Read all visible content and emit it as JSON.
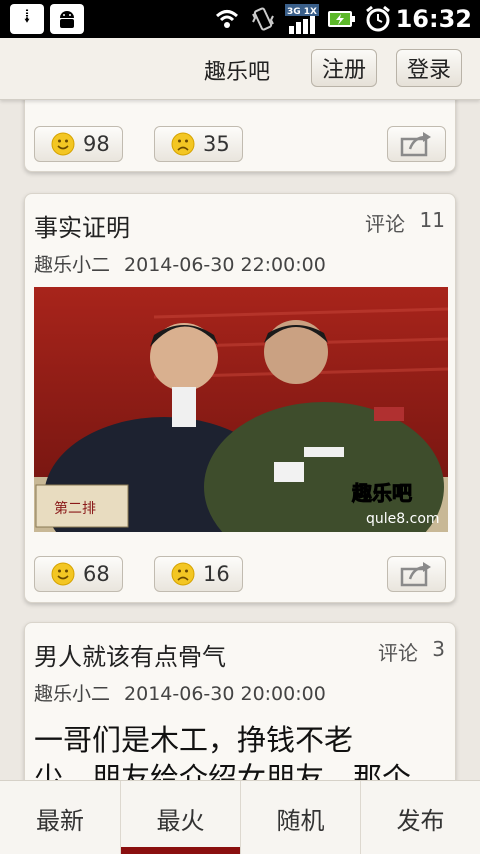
{
  "status_bar": {
    "time": "16:32",
    "network_label": "3G 1X",
    "icons": [
      "usb-icon",
      "android-icon",
      "wifi-icon",
      "vibrate-icon",
      "signal-icon",
      "battery-charging-icon",
      "alarm-icon"
    ]
  },
  "header": {
    "title": "趣乐吧",
    "register_label": "注册",
    "login_label": "登录"
  },
  "posts": [
    {
      "up_votes": "98",
      "down_votes": "35"
    },
    {
      "title": "事实证明",
      "comment_label": "评论",
      "comment_count": "11",
      "author": "趣乐小二",
      "date": "2014-06-30 22:00:00",
      "image_placard": "第二排",
      "image_watermark_brand": "趣乐吧",
      "image_watermark_url": "qule8.com",
      "up_votes": "68",
      "down_votes": "16"
    },
    {
      "title": "男人就该有点骨气",
      "comment_label": "评论",
      "comment_count": "3",
      "author": "趣乐小二",
      "date": "2014-06-30 20:00:00",
      "body_line1": "一哥们是木工，挣钱不老",
      "body_line2": "少，朋友给介绍女朋友，那个"
    }
  ],
  "tabs": [
    {
      "label": "最新",
      "active": false
    },
    {
      "label": "最火",
      "active": true
    },
    {
      "label": "随机",
      "active": false
    },
    {
      "label": "发布",
      "active": false
    }
  ],
  "colors": {
    "accent": "#8a0f0f",
    "background": "#ece8e2",
    "card": "#faf8f4",
    "smiley": "#f3c623"
  }
}
